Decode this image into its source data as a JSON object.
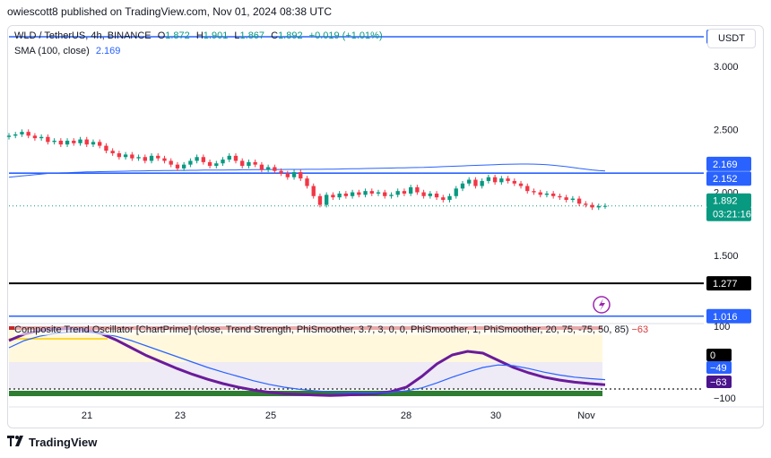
{
  "header": {
    "publisher": "owiescott8 published on TradingView.com, Nov 01, 2024 08:38 UTC"
  },
  "legend": {
    "symbol": "WLD / TetherUS, 4h, BINANCE",
    "o_label": "O",
    "o_value": "1.872",
    "h_label": "H",
    "h_value": "1.901",
    "l_label": "L",
    "l_value": "1.867",
    "c_label": "C",
    "c_value": "1.892",
    "change": "+0.019 (+1.01%)",
    "sma_label": "SMA (100, close)",
    "sma_value": "2.169"
  },
  "currency_button": "USDT",
  "footer": {
    "brand": "TradingView"
  },
  "colors": {
    "up": "#089981",
    "down": "#f23645",
    "sma": "#2962ff",
    "hline_blue": "#2962ff",
    "hline_black": "#000000"
  },
  "chart_data": [
    {
      "type": "candlestick",
      "title": "WLD / TetherUS, 4h, BINANCE",
      "y_scale": "linear",
      "ylim": [
        1.0,
        3.3
      ],
      "y_ticks": [
        "3.000",
        "2.500",
        "2.000",
        "1.500"
      ],
      "x_ticks": [
        "21",
        "23",
        "25",
        "28",
        "30",
        "Nov"
      ],
      "price_labels": [
        {
          "text": "3.236",
          "value": 3.236,
          "style": "blue-line"
        },
        {
          "text": "2.169",
          "value": 2.169,
          "style": "sma"
        },
        {
          "text": "2.152",
          "value": 2.152,
          "style": "blue-line"
        },
        {
          "text": "1.892",
          "value": 1.892,
          "style": "last"
        },
        {
          "text": "03:21:16",
          "value": 1.892,
          "style": "countdown"
        },
        {
          "text": "1.277",
          "value": 1.277,
          "style": "black-line"
        },
        {
          "text": "1.016",
          "value": 1.016,
          "style": "blue-line"
        }
      ],
      "horizontal_lines": [
        3.236,
        2.152,
        1.277,
        1.016
      ],
      "close": [
        2.45,
        2.46,
        2.48,
        2.45,
        2.43,
        2.44,
        2.4,
        2.41,
        2.38,
        2.41,
        2.39,
        2.42,
        2.38,
        2.4,
        2.37,
        2.33,
        2.31,
        2.28,
        2.3,
        2.27,
        2.28,
        2.25,
        2.29,
        2.27,
        2.25,
        2.22,
        2.19,
        2.22,
        2.25,
        2.28,
        2.24,
        2.21,
        2.23,
        2.26,
        2.29,
        2.25,
        2.21,
        2.24,
        2.22,
        2.18,
        2.2,
        2.17,
        2.15,
        2.12,
        2.16,
        2.11,
        2.05,
        1.97,
        1.9,
        1.98,
        1.96,
        1.99,
        1.97,
        2.0,
        1.98,
        2.01,
        1.99,
        2.0,
        1.97,
        1.98,
        2.01,
        1.99,
        2.04,
        2.0,
        1.97,
        1.99,
        1.96,
        1.94,
        1.97,
        2.03,
        2.07,
        2.1,
        2.05,
        2.09,
        2.12,
        2.08,
        2.11,
        2.09,
        2.07,
        2.05,
        2.01,
        2.0,
        1.98,
        1.99,
        1.97,
        1.96,
        1.94,
        1.95,
        1.91,
        1.9,
        1.88,
        1.89,
        1.892
      ],
      "sma": [
        2.12,
        2.125,
        2.13,
        2.135,
        2.14,
        2.145,
        2.15,
        2.152,
        2.154,
        2.156,
        2.158,
        2.16,
        2.162,
        2.163,
        2.164,
        2.165,
        2.166,
        2.167,
        2.168,
        2.169,
        2.17,
        2.171,
        2.172,
        2.172,
        2.173,
        2.173,
        2.174,
        2.174,
        2.175,
        2.175,
        2.176,
        2.176,
        2.177,
        2.177,
        2.178,
        2.178,
        2.179,
        2.179,
        2.18,
        2.18,
        2.181,
        2.181,
        2.181,
        2.182,
        2.182,
        2.182,
        2.183,
        2.183,
        2.183,
        2.184,
        2.184,
        2.185,
        2.186,
        2.187,
        2.188,
        2.189,
        2.19,
        2.191,
        2.192,
        2.193,
        2.194,
        2.195,
        2.196,
        2.197,
        2.198,
        2.2,
        2.202,
        2.204,
        2.206,
        2.208,
        2.21,
        2.212,
        2.214,
        2.216,
        2.218,
        2.22,
        2.222,
        2.223,
        2.224,
        2.225,
        2.225,
        2.224,
        2.222,
        2.219,
        2.215,
        2.21,
        2.204,
        2.197,
        2.19,
        2.184,
        2.178,
        2.173,
        2.169
      ]
    },
    {
      "type": "line",
      "title": "Composite Trend Oscillator [ChartPrime] (close, Trend Strength, PhiSmoother, 3.7, 3, 0, 0, PhiSmoother, 1, PhiSmoother, 20, 75, -75, 50, 85)",
      "title_value": "−63",
      "ylim": [
        -100,
        100
      ],
      "y_ticks": [
        "100",
        "0",
        "−100"
      ],
      "value_labels": [
        {
          "text": "0",
          "value": 0,
          "style": "black"
        },
        {
          "text": "−49",
          "value": -49,
          "style": "blue"
        },
        {
          "text": "−63",
          "value": -63,
          "style": "purple"
        }
      ],
      "reference_lines": [
        0,
        -75
      ],
      "series": [
        {
          "role": "fast",
          "color": "#6a1b9a",
          "values": [
            60,
            78,
            88,
            92,
            93,
            90,
            80,
            62,
            40,
            18,
            0,
            -18,
            -34,
            -48,
            -60,
            -70,
            -78,
            -84,
            -88,
            -90,
            -92,
            -93,
            -92,
            -90,
            -88,
            -82,
            -70,
            -40,
            -5,
            20,
            30,
            25,
            5,
            -15,
            -30,
            -42,
            -50,
            -56,
            -60,
            -63
          ]
        },
        {
          "role": "slow",
          "color": "#2962ff",
          "values": [
            40,
            60,
            72,
            80,
            84,
            84,
            80,
            72,
            60,
            45,
            30,
            15,
            0,
            -15,
            -28,
            -40,
            -52,
            -62,
            -70,
            -76,
            -80,
            -83,
            -85,
            -86,
            -86,
            -84,
            -80,
            -72,
            -58,
            -42,
            -28,
            -15,
            -8,
            -10,
            -18,
            -28,
            -36,
            -42,
            -46,
            -49
          ]
        }
      ]
    }
  ]
}
